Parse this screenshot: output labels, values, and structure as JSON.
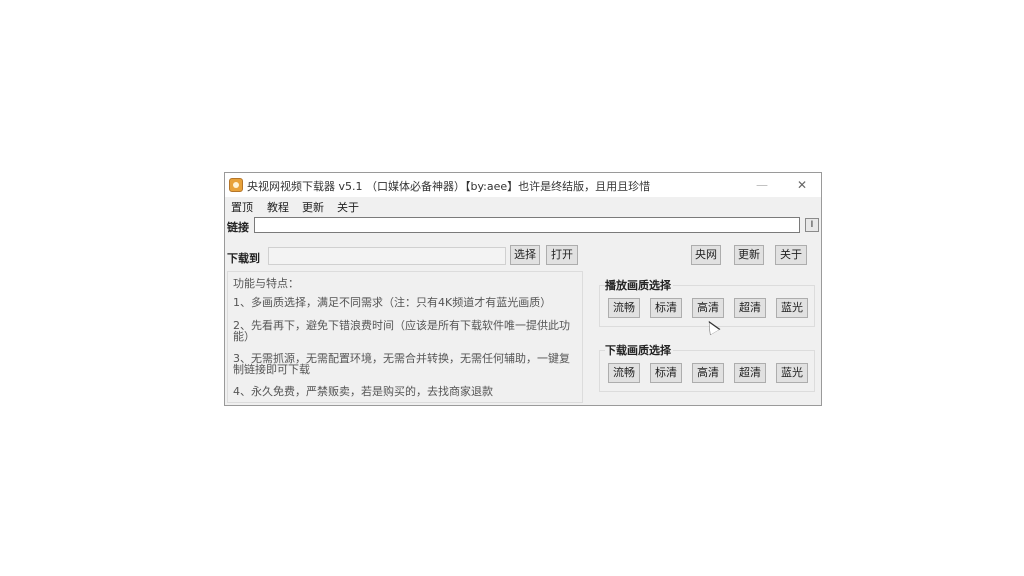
{
  "window": {
    "title": "央视网视频下载器  v5.1 （口媒体必备神器）【by:aee】也许是终结版，且用且珍惜",
    "close_icon": "✕"
  },
  "menu": [
    "置顶",
    "教程",
    "更新",
    "关于"
  ],
  "link": {
    "label": "链接",
    "value": "",
    "paste_icon": "paste-icon"
  },
  "download": {
    "label": "下载到",
    "path_value": "",
    "choose_label": "选择",
    "open_label": "打开"
  },
  "top_buttons": {
    "cctv_label": "央网",
    "update_label": "更新",
    "about_label": "关于"
  },
  "features": {
    "title": "功能与特点：",
    "items": [
      "1、多画质选择，满足不同需求（注：只有4K频道才有蓝光画质）",
      "2、先看再下，避免下错浪费时间（应该是所有下载软件唯一提供此功能）",
      "3、无需抓源，无需配置环境，无需合并转换，无需任何辅助，一键复制链接即可下载",
      "4、永久免费，严禁贩卖，若是购买的，去找商家退款"
    ]
  },
  "play_quality": {
    "title": "播放画质选择",
    "options": [
      "流畅",
      "标清",
      "高清",
      "超清",
      "蓝光"
    ]
  },
  "download_quality": {
    "title": "下载画质选择",
    "options": [
      "流畅",
      "标清",
      "高清",
      "超清",
      "蓝光"
    ]
  }
}
